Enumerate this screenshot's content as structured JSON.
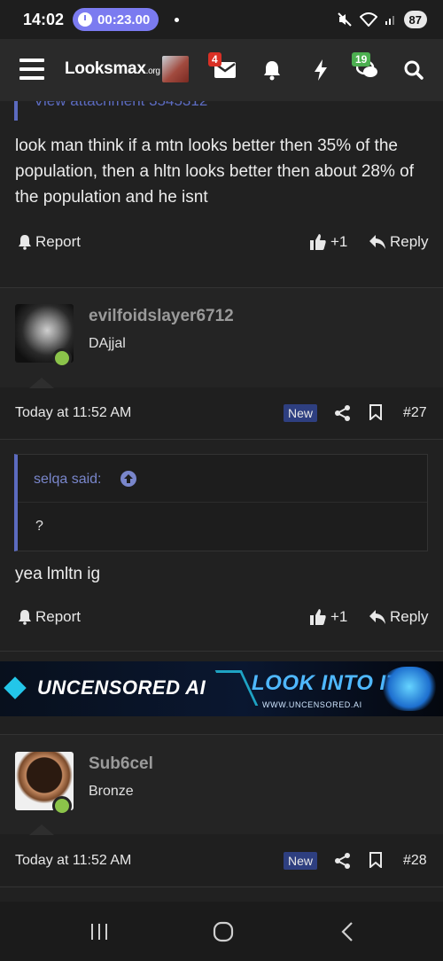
{
  "status_bar": {
    "time": "14:02",
    "recording_timer": "00:23.00",
    "battery": "87"
  },
  "header": {
    "logo_text": "Looksmax",
    "logo_suffix": ".org",
    "notifications_count": "4",
    "conversations_count": "19"
  },
  "top_post": {
    "attachment_text": "View attachment 3545312",
    "body": "look man think if a mtn looks better then 35% of the population, then a hltn looks better then about 28% of the population and he isnt",
    "report_label": "Report",
    "like_count": "+1",
    "reply_label": "Reply"
  },
  "post_27": {
    "username": "evilfoidslayer6712",
    "user_title": "DAjjal",
    "timestamp": "Today at 11:52 AM",
    "new_badge": "New",
    "post_number": "#27",
    "quote_author": "selqa said:",
    "quote_body": "?",
    "body": "yea lmltn ig",
    "report_label": "Report",
    "like_count": "+1",
    "reply_label": "Reply"
  },
  "ad": {
    "left_text": "UNCENSORED AI",
    "right_text": "LOOK INTO IT",
    "url_text": "WWW.UNCENSORED.AI"
  },
  "post_28": {
    "username": "Sub6cel",
    "user_title": "Bronze",
    "timestamp": "Today at 11:52 AM",
    "new_badge": "New",
    "post_number": "#28"
  },
  "colors": {
    "accent": "#5c6bc0",
    "background": "#212121",
    "online": "#8bc34a",
    "badge_red": "#d93025",
    "badge_green": "#4caf50"
  },
  "icons": [
    "hamburger-icon",
    "envelope-icon",
    "bell-icon",
    "bolt-icon",
    "chat-icon",
    "search-icon",
    "report-bell-icon",
    "thumbs-up-icon",
    "reply-arrow-icon",
    "share-icon",
    "bookmark-icon",
    "quote-up-arrow-icon",
    "nav-recents-icon",
    "nav-home-icon",
    "nav-back-icon"
  ]
}
